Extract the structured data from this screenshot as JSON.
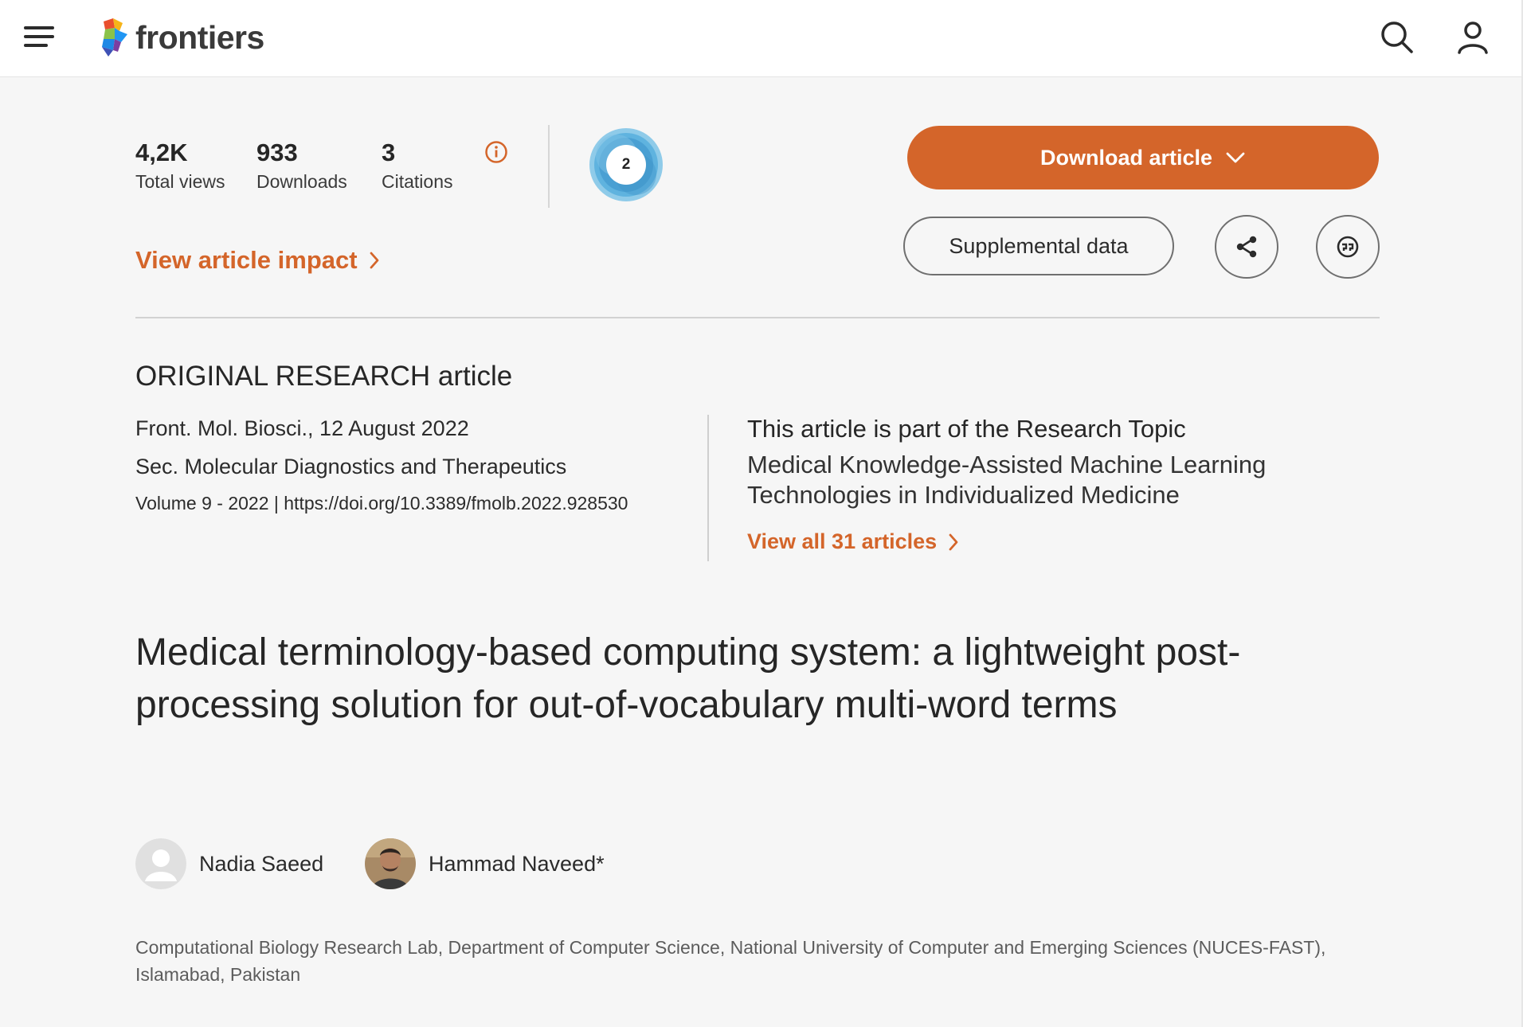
{
  "header": {
    "logo_text": "frontiers",
    "icons": [
      "menu-icon",
      "search-icon",
      "user-icon"
    ]
  },
  "metrics": {
    "total_views": {
      "value": "4,2K",
      "label": "Total views"
    },
    "downloads": {
      "value": "933",
      "label": "Downloads"
    },
    "citations": {
      "value": "3",
      "label": "Citations"
    },
    "altmetric_score": "2",
    "view_impact_label": "View article impact"
  },
  "actions": {
    "download_label": "Download article",
    "supplemental_label": "Supplemental data"
  },
  "article": {
    "type": "ORIGINAL RESEARCH article",
    "journal": "Front. Mol. Biosci., 12 August 2022",
    "section": "Sec. Molecular Diagnostics and Therapeutics",
    "volume_doi": "Volume 9 - 2022 | https://doi.org/10.3389/fmolb.2022.928530",
    "title": "Medical terminology-based computing system: a lightweight post-processing solution for out-of-vocabulary multi-word terms"
  },
  "research_topic": {
    "heading": "This article is part of the Research Topic",
    "title": "Medical Knowledge-Assisted Machine Learning Technologies in Individualized Medicine",
    "view_all_label": "View all 31 articles"
  },
  "authors": [
    {
      "name": "Nadia Saeed"
    },
    {
      "name": "Hammad Naveed*"
    }
  ],
  "affiliation": "Computational Biology Research Lab, Department of Computer Science, National University of Computer and Emerging Sciences (NUCES-FAST), Islamabad, Pakistan",
  "colors": {
    "accent": "#d4652a",
    "background": "#f6f6f6",
    "altmetric_blue": "#4aa8d8"
  }
}
